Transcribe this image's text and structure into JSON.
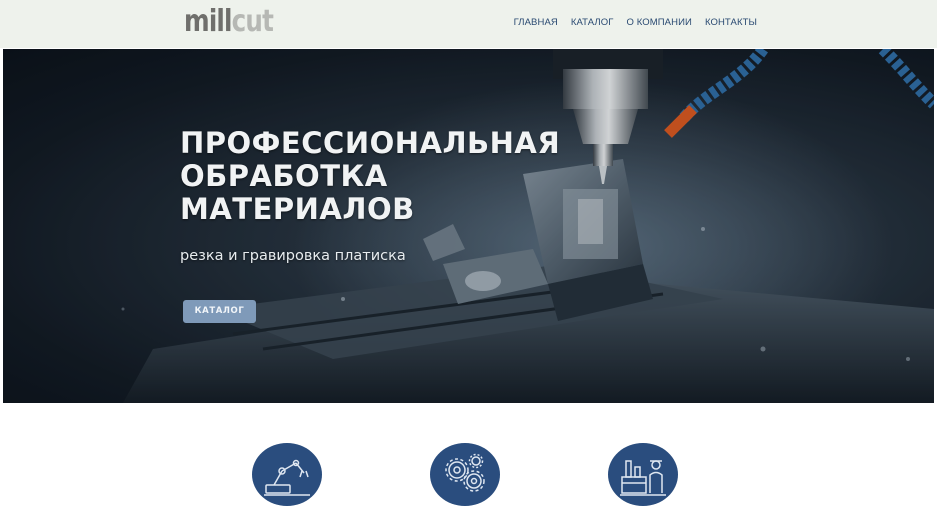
{
  "header": {
    "logo_left": "mill",
    "logo_right": "cut",
    "nav": [
      "ГЛАВНАЯ",
      "КАТАЛОГ",
      "О КОМПАНИИ",
      "КОНТАКТЫ"
    ]
  },
  "hero": {
    "title_lines": [
      "ПРОФЕССИОНАЛЬНАЯ",
      "ОБРАБОТКА",
      "МАТЕРИАЛОВ"
    ],
    "subtitle": "резка и гравировка платиска",
    "button_label": "КАТАЛОГ",
    "button_color": "#7f9ab9",
    "image": "cnc-milling-machine-photo"
  },
  "features": {
    "icons": [
      "robot-arm-icon",
      "gears-icon",
      "factory-worker-icon"
    ],
    "icon_bg_color": "#2a4d7e"
  },
  "colors": {
    "header_bg": "#eef2ec",
    "nav_text": "#2a4a72",
    "accent": "#2a4d7e"
  }
}
